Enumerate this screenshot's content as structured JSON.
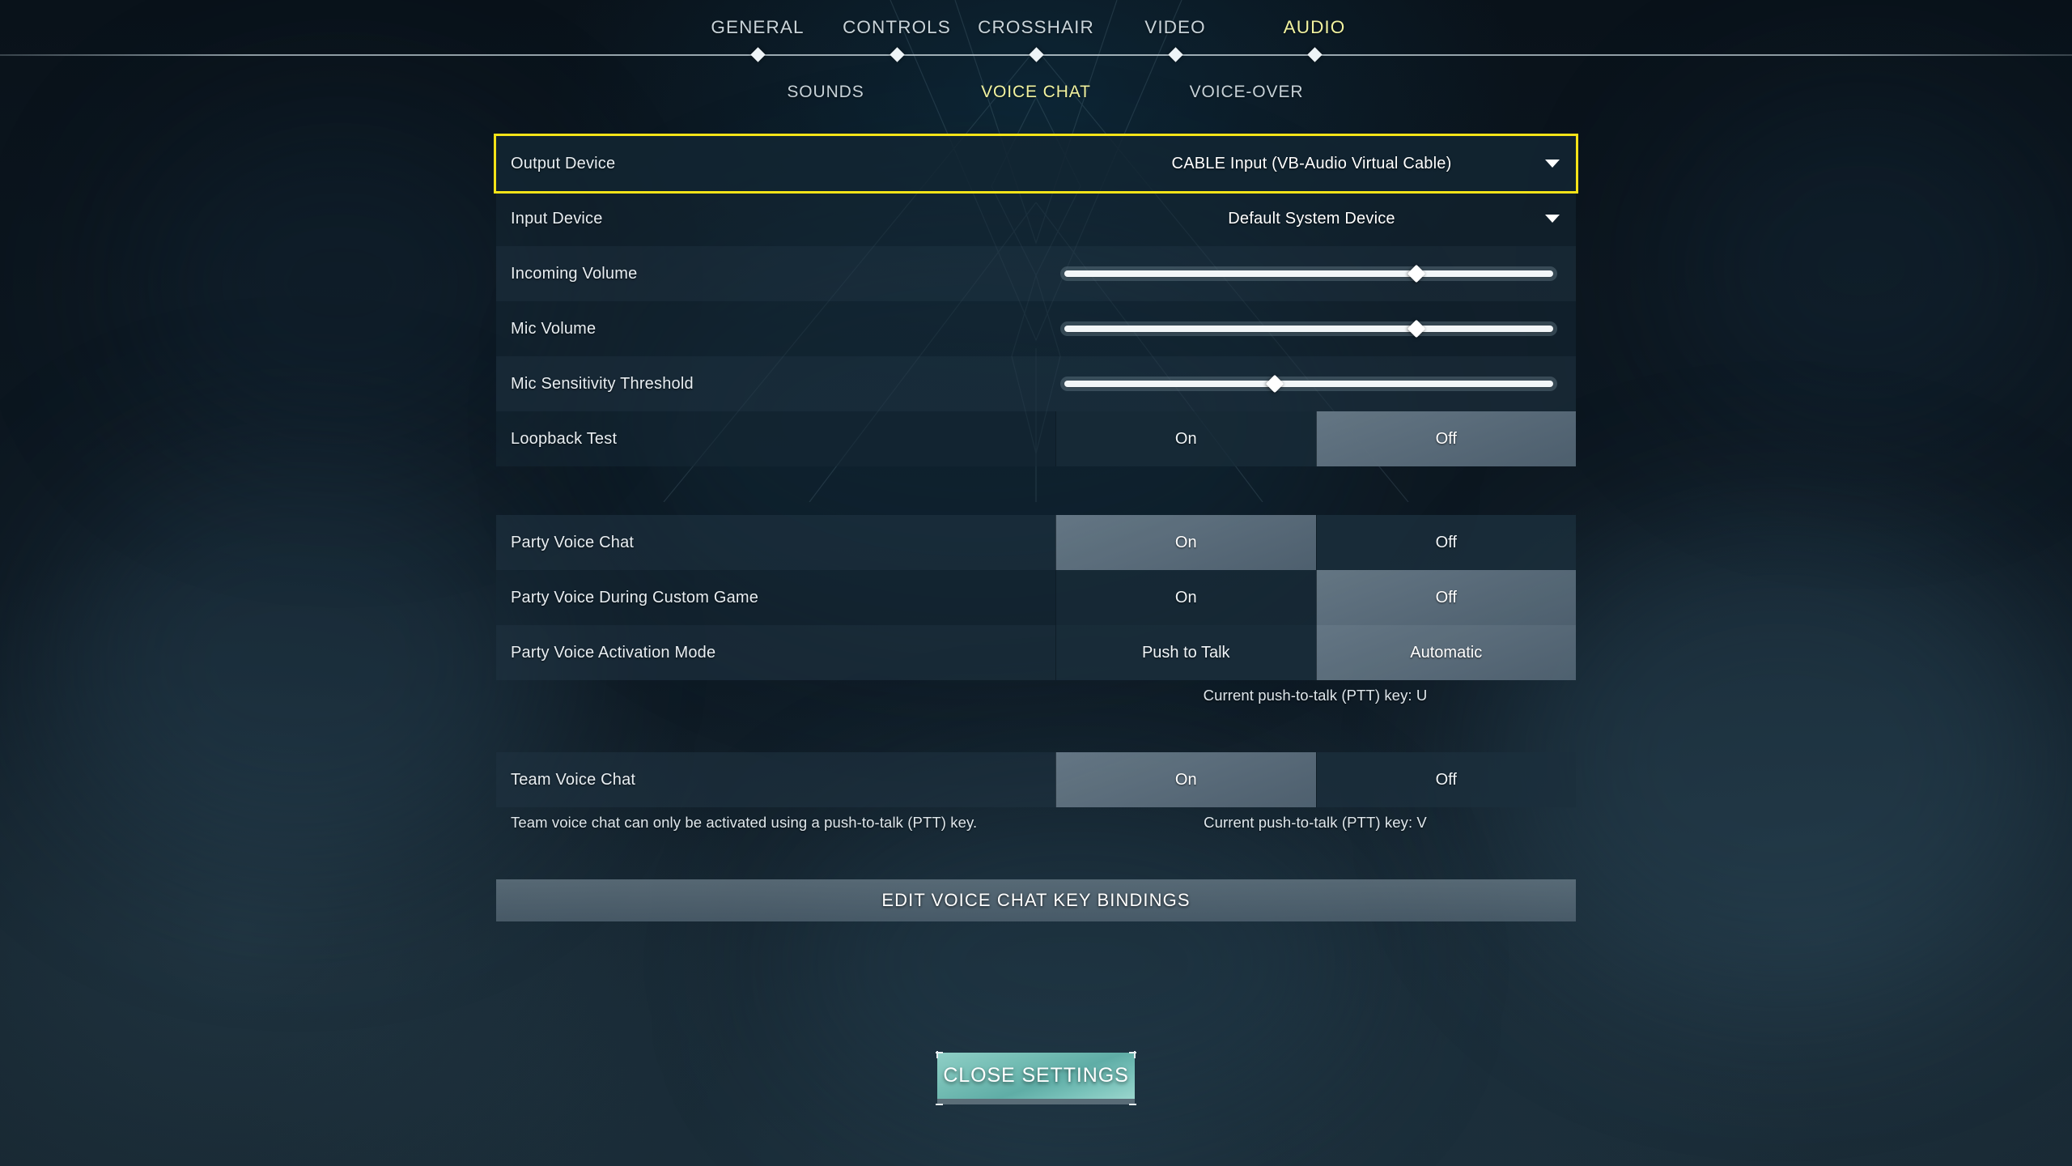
{
  "topnav": {
    "items": [
      {
        "label": "GENERAL",
        "active": false
      },
      {
        "label": "CONTROLS",
        "active": false
      },
      {
        "label": "CROSSHAIR",
        "active": false
      },
      {
        "label": "VIDEO",
        "active": false
      },
      {
        "label": "AUDIO",
        "active": true
      }
    ],
    "active_color": "#f2f3a0",
    "inactive_color": "#c9d4da"
  },
  "subnav": {
    "items": [
      {
        "label": "SOUNDS",
        "active": false
      },
      {
        "label": "VOICE CHAT",
        "active": true
      },
      {
        "label": "VOICE-OVER",
        "active": false
      }
    ]
  },
  "settings": {
    "output_device": {
      "label": "Output Device",
      "value": "CABLE Input (VB-Audio Virtual Cable)",
      "icon": "chevron-down-icon",
      "highlighted": true,
      "highlight_color": "#f5e318"
    },
    "input_device": {
      "label": "Input Device",
      "value": "Default System Device",
      "icon": "chevron-down-icon"
    },
    "incoming_volume": {
      "label": "Incoming Volume",
      "percent": 72
    },
    "mic_volume": {
      "label": "Mic Volume",
      "percent": 72
    },
    "mic_sensitivity_threshold": {
      "label": "Mic Sensitivity Threshold",
      "percent": 43
    },
    "loopback_test": {
      "label": "Loopback Test",
      "options": [
        "On",
        "Off"
      ],
      "selected": "Off"
    },
    "party_voice_chat": {
      "label": "Party Voice Chat",
      "options": [
        "On",
        "Off"
      ],
      "selected": "On"
    },
    "party_voice_custom_game": {
      "label": "Party Voice During Custom Game",
      "options": [
        "On",
        "Off"
      ],
      "selected": "Off"
    },
    "party_voice_activation_mode": {
      "label": "Party Voice Activation Mode",
      "options": [
        "Push to Talk",
        "Automatic"
      ],
      "selected": "Automatic"
    },
    "party_ptt_hint": "Current push-to-talk (PTT) key: U",
    "team_voice_chat": {
      "label": "Team Voice Chat",
      "options": [
        "On",
        "Off"
      ],
      "selected": "On"
    },
    "team_voice_note": "Team voice chat can only be activated using a push-to-talk (PTT) key.",
    "team_ptt_hint": "Current push-to-talk (PTT) key: V"
  },
  "buttons": {
    "edit_bindings": "EDIT VOICE CHAT KEY BINDINGS",
    "close_settings": "CLOSE SETTINGS"
  }
}
